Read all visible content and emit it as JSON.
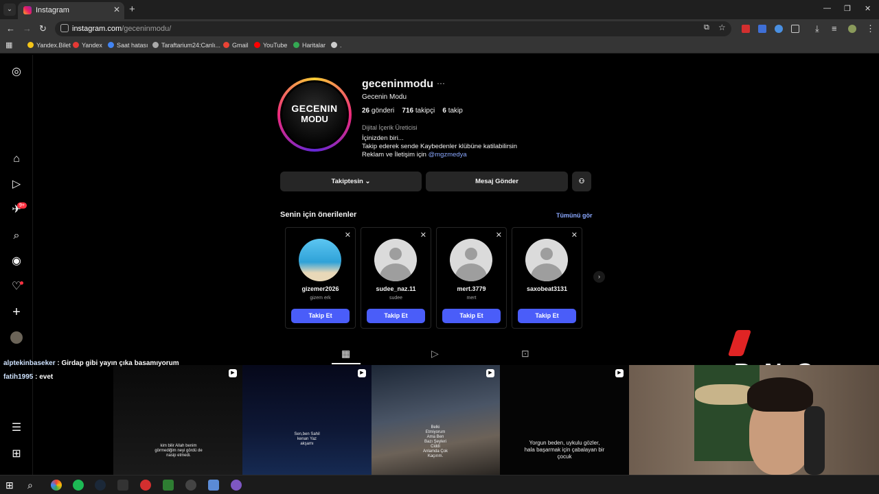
{
  "browser": {
    "tab_title": "Instagram",
    "url_host": "instagram.com",
    "url_path": "/geceninmodu/",
    "bookmarks": [
      "Yandex.Bilet",
      "Yandex",
      "Saat hatası",
      "Taraftarium24:Canlı...",
      "Gmail",
      "YouTube",
      "Haritalar",
      "."
    ]
  },
  "profile": {
    "username": "geceninmodu",
    "full_name": "Gecenin Modu",
    "avatar_text_line1": "GECENIN",
    "avatar_text_line2": "MODU",
    "posts_count": "26",
    "posts_label": "gönderi",
    "followers_count": "716",
    "followers_label": "takipçi",
    "following_count": "6",
    "following_label": "takip",
    "category": "Dijital İçerik Üreticisi",
    "bio_line1": "İçinizden biri...",
    "bio_line2": "Takip ederek sende Kaybedenler klübüne katilabilirsin",
    "bio_line3_prefix": "Reklam ve İletişim için ",
    "bio_mention": "@mgzmedya",
    "following_button": "Takiptesin",
    "message_button": "Mesaj Gönder"
  },
  "suggestions": {
    "title": "Senin için önerilenler",
    "see_all": "Tümünü gör",
    "items": [
      {
        "username": "gizemer2026",
        "name": "gizem erk",
        "button": "Takip Et"
      },
      {
        "username": "sudee_naz.11",
        "name": "sudee",
        "button": "Takip Et"
      },
      {
        "username": "mert.3779",
        "name": "mert",
        "button": "Takip Et"
      },
      {
        "username": "saxobeat3131",
        "name": "",
        "button": "Takip Et"
      }
    ]
  },
  "posts": [
    {
      "text": "kim bilir Allah benim görmediğim neyi gördü de nasip etmedi."
    },
    {
      "text": "Sen,ben Sahil kenarı Yaz akşamı"
    },
    {
      "text": "Belki Etmiyorum Ama Ben Bazı Şeyleri Ciddi Anlamda Çok Kaçırım."
    },
    {
      "text": "Yorgun beden, uykulu gözler, hala başarmak için çabalayan bir çocuk"
    }
  ],
  "stream": {
    "chat": [
      {
        "user": "alptekinbaseker",
        "message": " : Girdap gibi yayın çıka basamıyorum"
      },
      {
        "user": "fatih1995",
        "message": " : evet"
      }
    ],
    "sponsor": "ByNoGame"
  },
  "sidebar": {
    "notifications_badge": "9+"
  },
  "colors": {
    "accent": "#4a5df9",
    "link": "#8aa8ff",
    "background": "#000000",
    "badge": "#ff3040"
  }
}
